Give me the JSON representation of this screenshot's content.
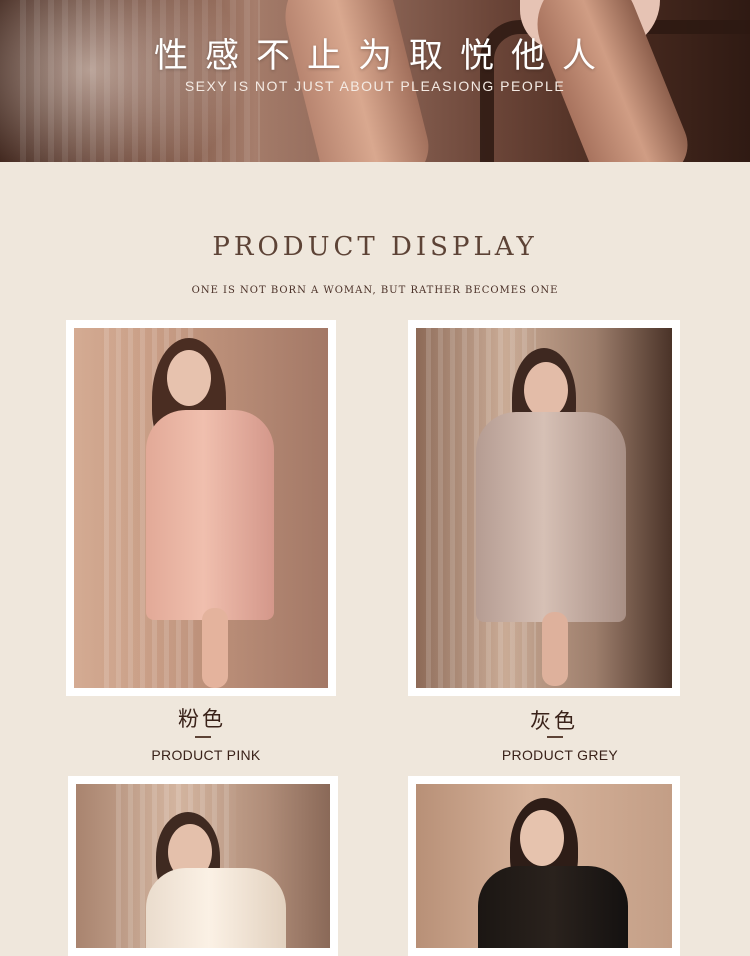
{
  "hero": {
    "title": "性感不止为取悦他人",
    "subtitle": "SEXY IS NOT JUST ABOUT PLEASIONG PEOPLE"
  },
  "section": {
    "title": "PRODUCT DISPLAY",
    "subtitle": "one is not born a woman, but rather becomes one"
  },
  "products": [
    {
      "name_cn": "粉色",
      "name_en": "PRODUCT PINK",
      "color": "#e7b1a0"
    },
    {
      "name_cn": "灰色",
      "name_en": "PRODUCT GREY",
      "color": "#bfa7a0"
    },
    {
      "color": "#f3e4d3"
    },
    {
      "color": "#1b1613"
    }
  ],
  "colors": {
    "background": "#efe7dc",
    "text_dark": "#3a2219",
    "heading": "#5d4336"
  }
}
